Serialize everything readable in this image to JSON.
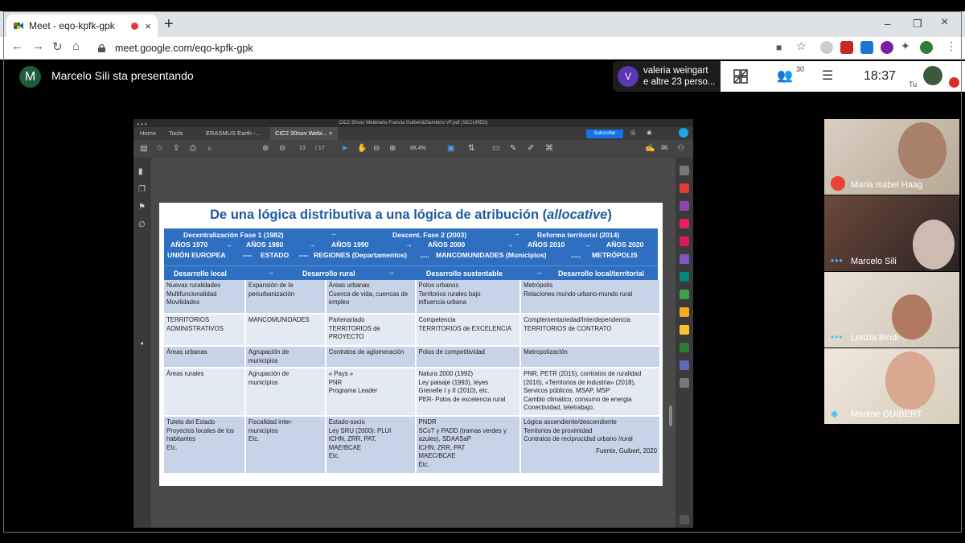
{
  "browser": {
    "tab_title": "Meet - eqo-kpfk-gpk",
    "tab_close": "×",
    "new_tab": "+",
    "url": "meet.google.com/eqo-kpfk-gpk",
    "win_min": "–",
    "win_max": "❐",
    "win_close": "×"
  },
  "meet": {
    "presenter_initial": "M",
    "presenting_text": "Marcelo Sili sta presentando",
    "viewer_initial": "V",
    "viewer_line1": "valeria weingart",
    "viewer_line2": "e altre 23 perso...",
    "participants_count": "30",
    "clock": "18:37",
    "self_label": "Tu"
  },
  "pdf": {
    "window_title": "CIC2 30nov Webinario Francia Guibert&Gambino VF.pdf (SECURED)",
    "tabs": [
      "Home",
      "Tools",
      "ERASMUS Earth -...",
      "CIC2 30nov Webi..."
    ],
    "tab_close": "×",
    "subscribe": "Subscribe",
    "page_current": "13",
    "page_total": "/ 17",
    "zoom": "88.4%"
  },
  "slide": {
    "title_main": "De una lógica distributiva a una lógica de atribución (",
    "title_italic": "allocative",
    "title_end": ")",
    "band": {
      "r1a": "Decentralización Fase 1 (1982)",
      "r1b": "→",
      "r1c": "Descent. Fase 2 (2003)",
      "r1d": "→",
      "r1e": "Reforma territorial (2014)",
      "r2": [
        "AÑOS 1970",
        "→",
        "AÑOS 1980",
        "→",
        "AÑOS 1990",
        "→",
        "AÑOS 2000",
        "→",
        "AÑOS 2010",
        "→",
        "AÑOS 2020"
      ],
      "r3": [
        "UNIÓN EUROPEA",
        "----",
        "ESTADO",
        "----",
        "REGIONES (Departamentos)",
        ".....",
        "MANCOMUNIDADES (Municipios)",
        ".....",
        "METRÓPOLIS"
      ]
    },
    "band2": [
      "Desarrollo local",
      "→",
      "Desarrollo rural",
      "→",
      "Desarrollo sustentable",
      "→",
      "Desarrollo local/territorial"
    ],
    "rows": [
      [
        "Nuevas ruralidades\nMultifuncionalidad\nMovilidades",
        "Expansión de la\nperiurbanización",
        "Áreas urbanas\nCuenca de vida, cuencas de\nempleo",
        "Polos urbanos\nTerritorios rurales bajo\ninfluencia urbana",
        "Metrópolis\nRelaciones mundo urbano-mundo rural"
      ],
      [
        "TERRITORIOS\nADMINISTRATIVOS",
        "MANCOMUNIDADES",
        "Partenariado\nTERRITORIOS de\nPROYECTO",
        "Competencia\nTERRITORIOS de EXCELENCIA",
        "Complementariedad/Interdependencia\nTERRITORIOS  de CONTRATO"
      ],
      [
        "Áreas urbanas",
        "Agrupación de\nmunicipios",
        "Contratos de aglomeración",
        "Polos de competitividad",
        "Metropolización"
      ],
      [
        "Áreas rurales",
        "Agrupación de\nmunicipios",
        "« Pays »\nPNR\nPrograma Leader",
        "Natura 2000 (1992)\nLey paisaje (1993), leyes\nGrenelle I y II (2010), etc.\nPER- Polos de excelencia rural",
        "PNR, PETR (2015), contratos de ruralidad\n(2016), «Territorios de industria» (2018),\nServicos públicos, MSAP, MSP\nCambio climático, consumo de energia\nConectividad, teletrabajo,"
      ],
      [
        "Tutela del Estado\nProyectos locales de los\nhabitantes\nEtc.",
        "Fiscalidad inter-\nmunicipios\nEtc.",
        "Estado-socio\nLey SRU (2000): PLUI\nICHN, ZRR, PAT,\nMAE/BCAE\nEtc.",
        "PNDR\nSCoT y PADD (tramas verdes y\nazules), SDAASaP\nICHN, ZRR, PAT\nMAEC/BCAE\nEtc.",
        "Lógica ascendiente/descendiente\nTerritorios de proximidad\nContratos de reciprocidad urbano /rural"
      ]
    ],
    "credit": "Fuente, Guibert, 2020"
  },
  "participants": [
    {
      "name": "Maria Isabel Haag",
      "status": "muted"
    },
    {
      "name": "Marcelo Sili",
      "status": "speaking"
    },
    {
      "name": "Letizia Bindi",
      "status": "speaking"
    },
    {
      "name": "Martine GUIBERT",
      "status": "active"
    }
  ],
  "colors": {
    "slide_blue": "#2f6fc2",
    "title_blue": "#1f5a9e",
    "meet_red": "#ea4335"
  }
}
